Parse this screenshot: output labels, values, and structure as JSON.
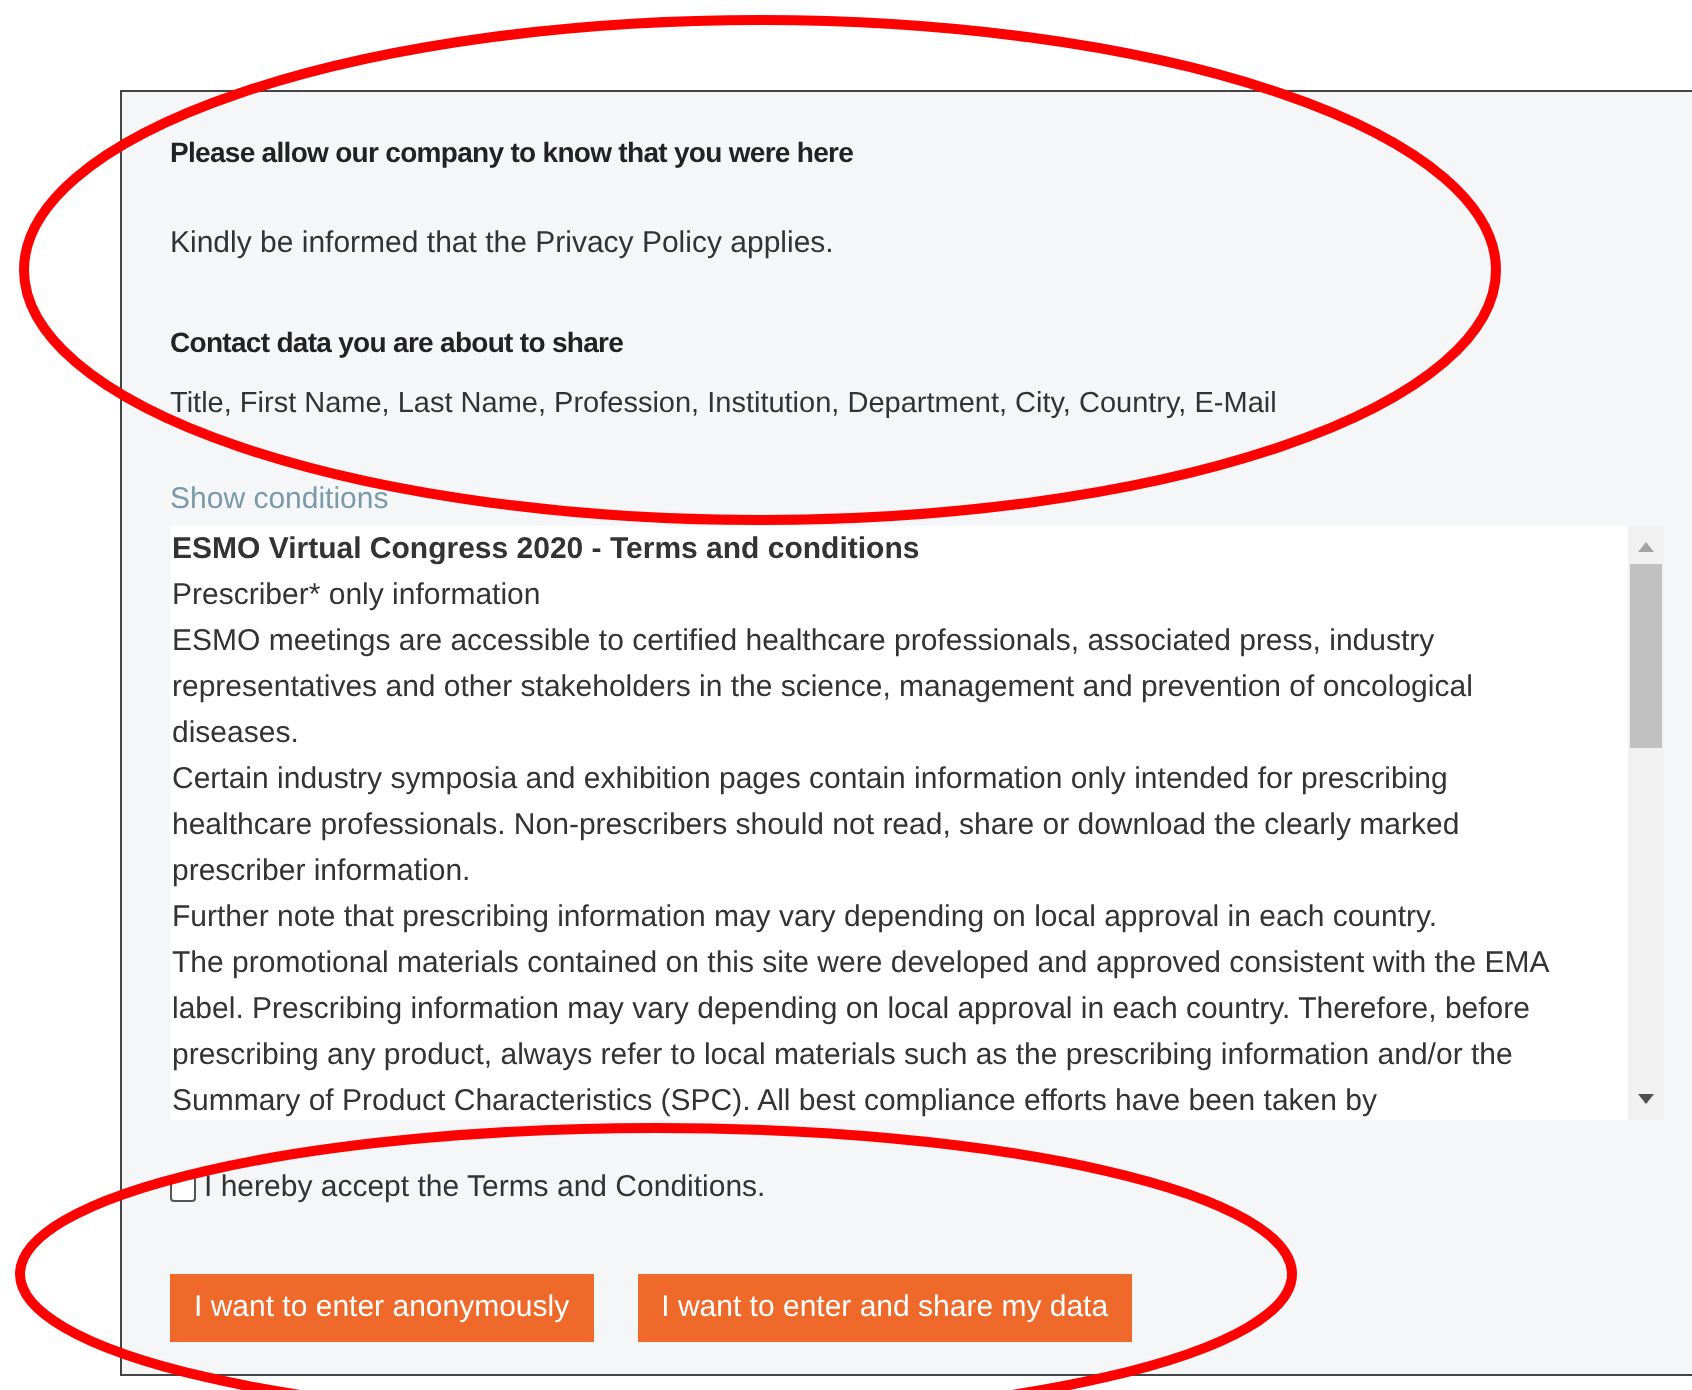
{
  "notice": {
    "heading": "Please allow our company to know that you were here",
    "text": "Kindly be informed that the Privacy Policy applies."
  },
  "contact": {
    "heading": "Contact data you are about to share",
    "fields": "Title, First Name, Last Name, Profession, Institution, Department, City, Country, E-Mail"
  },
  "show_conditions_link": "Show conditions",
  "terms": {
    "title": "ESMO Virtual Congress 2020 - Terms and conditions",
    "paragraphs": [
      "Prescriber* only information",
      "ESMO meetings are accessible to certified healthcare professionals, associated press, industry representatives and other stakeholders in the science, management and prevention of oncological diseases.",
      "Certain industry symposia and exhibition pages contain information only intended for prescribing healthcare professionals. Non-prescribers should not read, share or download the clearly marked prescriber information.",
      "Further note that prescribing information may vary depending on local approval in each country.",
      "The promotional materials contained on this site were developed and approved consistent with the EMA label. Prescribing information may vary depending on local approval in each country. Therefore, before prescribing any product, always refer to local materials such as the prescribing information and/or the Summary of Product Characteristics (SPC). All best compliance efforts have been taken by"
    ]
  },
  "accept": {
    "label": "I hereby accept the Terms and Conditions.",
    "checked": false
  },
  "buttons": [
    "I want to enter anonymously",
    "I want to enter and share my data"
  ]
}
